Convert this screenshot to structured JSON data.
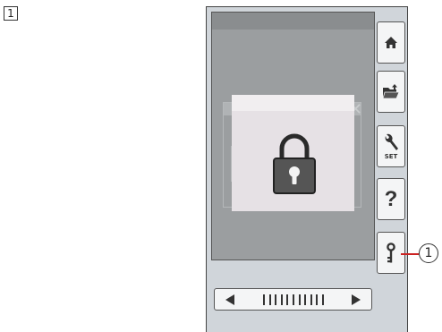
{
  "step_number": "1",
  "callout_number": "1",
  "sidebar": {
    "buttons": [
      {
        "name": "home",
        "icon": "home-icon"
      },
      {
        "name": "open-file",
        "icon": "folder-open-icon"
      },
      {
        "name": "settings",
        "icon": "wrench-icon",
        "label": "SET"
      },
      {
        "name": "help",
        "icon": "help-icon",
        "label": "?"
      },
      {
        "name": "key-lock",
        "icon": "key-icon"
      }
    ]
  },
  "dialog": {
    "icon": "padlock-icon"
  },
  "scrollbar": {
    "left_icon": "arrow-left-icon",
    "right_icon": "arrow-right-icon",
    "tick_count": 11
  },
  "colors": {
    "screen": "#9b9ea0",
    "dialog": "#e6e1e5",
    "callout_line": "#cc2222"
  }
}
